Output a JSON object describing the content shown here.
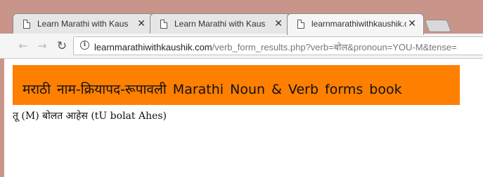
{
  "browser": {
    "tabs": [
      {
        "title": "Learn Marathi with Kaush",
        "close": "✕"
      },
      {
        "title": "Learn Marathi with Kaush",
        "close": "✕"
      },
      {
        "title": "learnmarathiwithkaushik.c",
        "close": "✕"
      }
    ],
    "nav": {
      "back": "←",
      "forward": "→",
      "reload": "↻"
    },
    "address": {
      "host": "learnmarathiwithkaushik.com",
      "path": "/verb_form_results.php?verb=बोल&pronoun=YOU-M&tense="
    }
  },
  "page": {
    "banner": "मराठी नाम-क्रियापद-रूपावली Marathi Noun & Verb forms book",
    "banner_color": "#ff7f00",
    "result": "तू (M) बोलत आहेस (tU bolat Ahes)"
  }
}
